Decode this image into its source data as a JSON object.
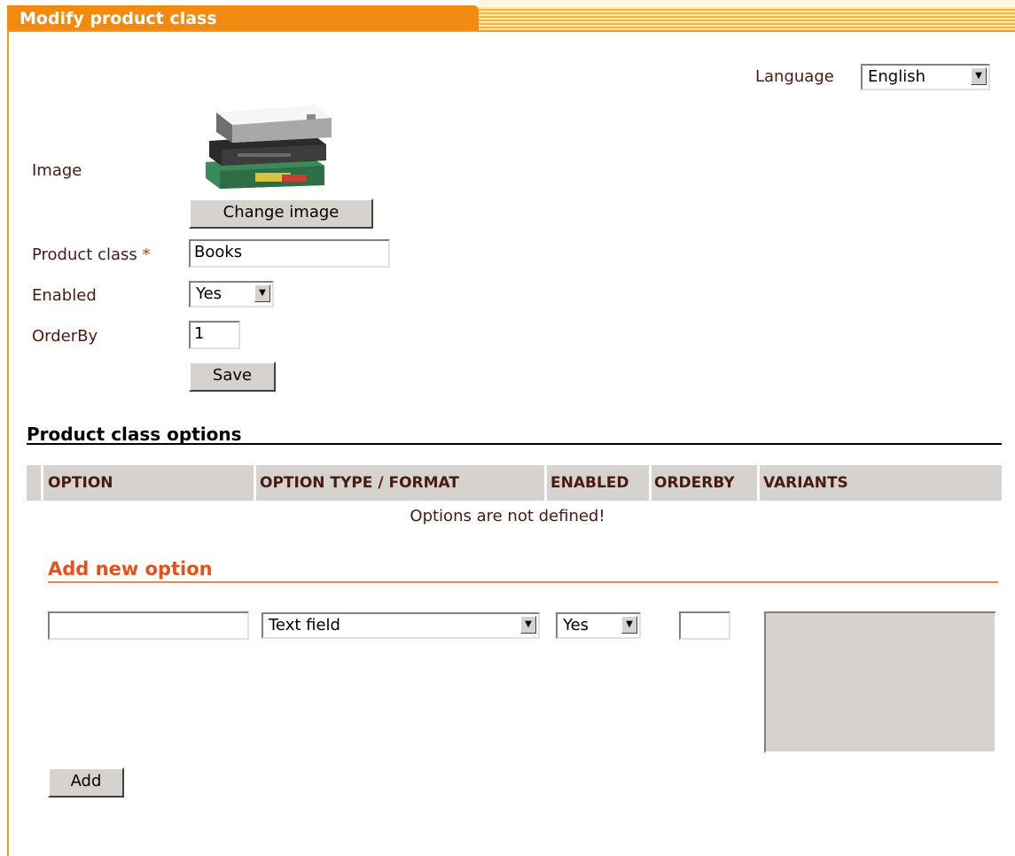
{
  "header": {
    "title": "Modify product class"
  },
  "language": {
    "label": "Language",
    "value": "English"
  },
  "form": {
    "image_label": "Image",
    "change_image": "Change image",
    "product_class_label": "Product class",
    "required_mark": "*",
    "product_class_value": "Books",
    "enabled_label": "Enabled",
    "enabled_value": "Yes",
    "orderby_label": "OrderBy",
    "orderby_value": "1",
    "save": "Save"
  },
  "options": {
    "title": "Product class options",
    "columns": [
      "OPTION",
      "OPTION TYPE / FORMAT",
      "ENABLED",
      "ORDERBY",
      "VARIANTS"
    ],
    "empty_message": "Options are not defined!"
  },
  "add_option": {
    "title": "Add new option",
    "name_value": "",
    "type_value": "Text field",
    "enabled_value": "Yes",
    "orderby_value": "",
    "add": "Add"
  }
}
